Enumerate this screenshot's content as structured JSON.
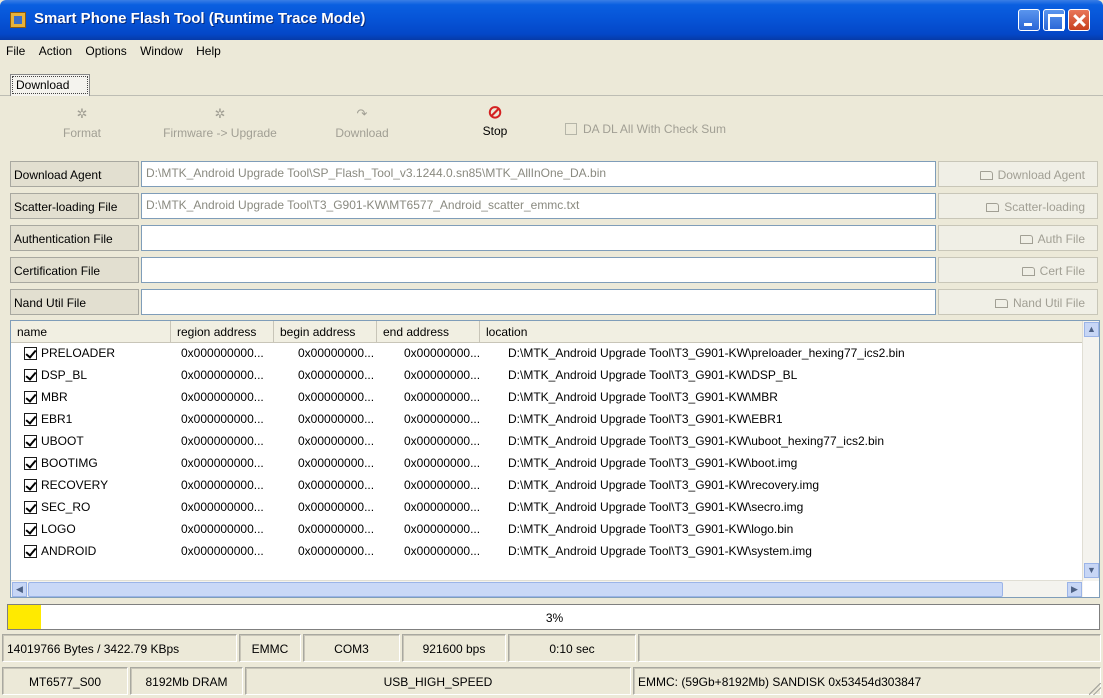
{
  "window": {
    "title": "Smart Phone Flash Tool (Runtime Trace Mode)"
  },
  "menu": [
    "File",
    "Action",
    "Options",
    "Window",
    "Help"
  ],
  "tabs": [
    {
      "label": "Download"
    }
  ],
  "toolbar": {
    "format": {
      "label": "Format",
      "icon": "format-icon"
    },
    "upgrade": {
      "label": "Firmware -> Upgrade",
      "icon": "upgrade-icon"
    },
    "download": {
      "label": "Download",
      "icon": "download-icon"
    },
    "stop": {
      "label": "Stop",
      "icon": "stop-icon",
      "color": "#d42020"
    },
    "da_checksum": {
      "label": "DA DL All With Check Sum",
      "checked": false
    }
  },
  "files": [
    {
      "label": "Download Agent",
      "value": "D:\\MTK_Android Upgrade Tool\\SP_Flash_Tool_v3.1244.0.sn85\\MTK_AllInOne_DA.bin",
      "button": "Download Agent"
    },
    {
      "label": "Scatter-loading File",
      "value": "D:\\MTK_Android Upgrade Tool\\T3_G901-KW\\MT6577_Android_scatter_emmc.txt",
      "button": "Scatter-loading"
    },
    {
      "label": "Authentication File",
      "value": "",
      "button": "Auth File"
    },
    {
      "label": "Certification File",
      "value": "",
      "button": "Cert File"
    },
    {
      "label": "Nand Util File",
      "value": "",
      "button": "Nand Util File"
    }
  ],
  "table": {
    "columns": [
      "name",
      "region address",
      "begin address",
      "end address",
      "location"
    ],
    "rows": [
      {
        "name": "PRELOADER",
        "region": "0x000000000...",
        "begin": "0x00000000...",
        "end": "0x00000000...",
        "location": "D:\\MTK_Android Upgrade Tool\\T3_G901-KW\\preloader_hexing77_ics2.bin",
        "checked": true
      },
      {
        "name": "DSP_BL",
        "region": "0x000000000...",
        "begin": "0x00000000...",
        "end": "0x00000000...",
        "location": "D:\\MTK_Android Upgrade Tool\\T3_G901-KW\\DSP_BL",
        "checked": true
      },
      {
        "name": "MBR",
        "region": "0x000000000...",
        "begin": "0x00000000...",
        "end": "0x00000000...",
        "location": "D:\\MTK_Android Upgrade Tool\\T3_G901-KW\\MBR",
        "checked": true
      },
      {
        "name": "EBR1",
        "region": "0x000000000...",
        "begin": "0x00000000...",
        "end": "0x00000000...",
        "location": "D:\\MTK_Android Upgrade Tool\\T3_G901-KW\\EBR1",
        "checked": true
      },
      {
        "name": "UBOOT",
        "region": "0x000000000...",
        "begin": "0x00000000...",
        "end": "0x00000000...",
        "location": "D:\\MTK_Android Upgrade Tool\\T3_G901-KW\\uboot_hexing77_ics2.bin",
        "checked": true
      },
      {
        "name": "BOOTIMG",
        "region": "0x000000000...",
        "begin": "0x00000000...",
        "end": "0x00000000...",
        "location": "D:\\MTK_Android Upgrade Tool\\T3_G901-KW\\boot.img",
        "checked": true
      },
      {
        "name": "RECOVERY",
        "region": "0x000000000...",
        "begin": "0x00000000...",
        "end": "0x00000000...",
        "location": "D:\\MTK_Android Upgrade Tool\\T3_G901-KW\\recovery.img",
        "checked": true
      },
      {
        "name": "SEC_RO",
        "region": "0x000000000...",
        "begin": "0x00000000...",
        "end": "0x00000000...",
        "location": "D:\\MTK_Android Upgrade Tool\\T3_G901-KW\\secro.img",
        "checked": true
      },
      {
        "name": "LOGO",
        "region": "0x000000000...",
        "begin": "0x00000000...",
        "end": "0x00000000...",
        "location": "D:\\MTK_Android Upgrade Tool\\T3_G901-KW\\logo.bin",
        "checked": true
      },
      {
        "name": "ANDROID",
        "region": "0x000000000...",
        "begin": "0x00000000...",
        "end": "0x00000000...",
        "location": "D:\\MTK_Android Upgrade Tool\\T3_G901-KW\\system.img",
        "checked": true
      }
    ]
  },
  "progress": {
    "value": 0.03,
    "label": "3%",
    "color": "#ffea00"
  },
  "status1": {
    "transfer": "14019766 Bytes / 3422.79 KBps",
    "storage": "EMMC",
    "port": "COM3",
    "baud": "921600 bps",
    "time": "0:10 sec"
  },
  "status2": {
    "chip": "MT6577_S00",
    "dram": "8192Mb DRAM",
    "usb": "USB_HIGH_SPEED",
    "emmc": "EMMC: (59Gb+8192Mb) SANDISK 0x53454d303847"
  }
}
